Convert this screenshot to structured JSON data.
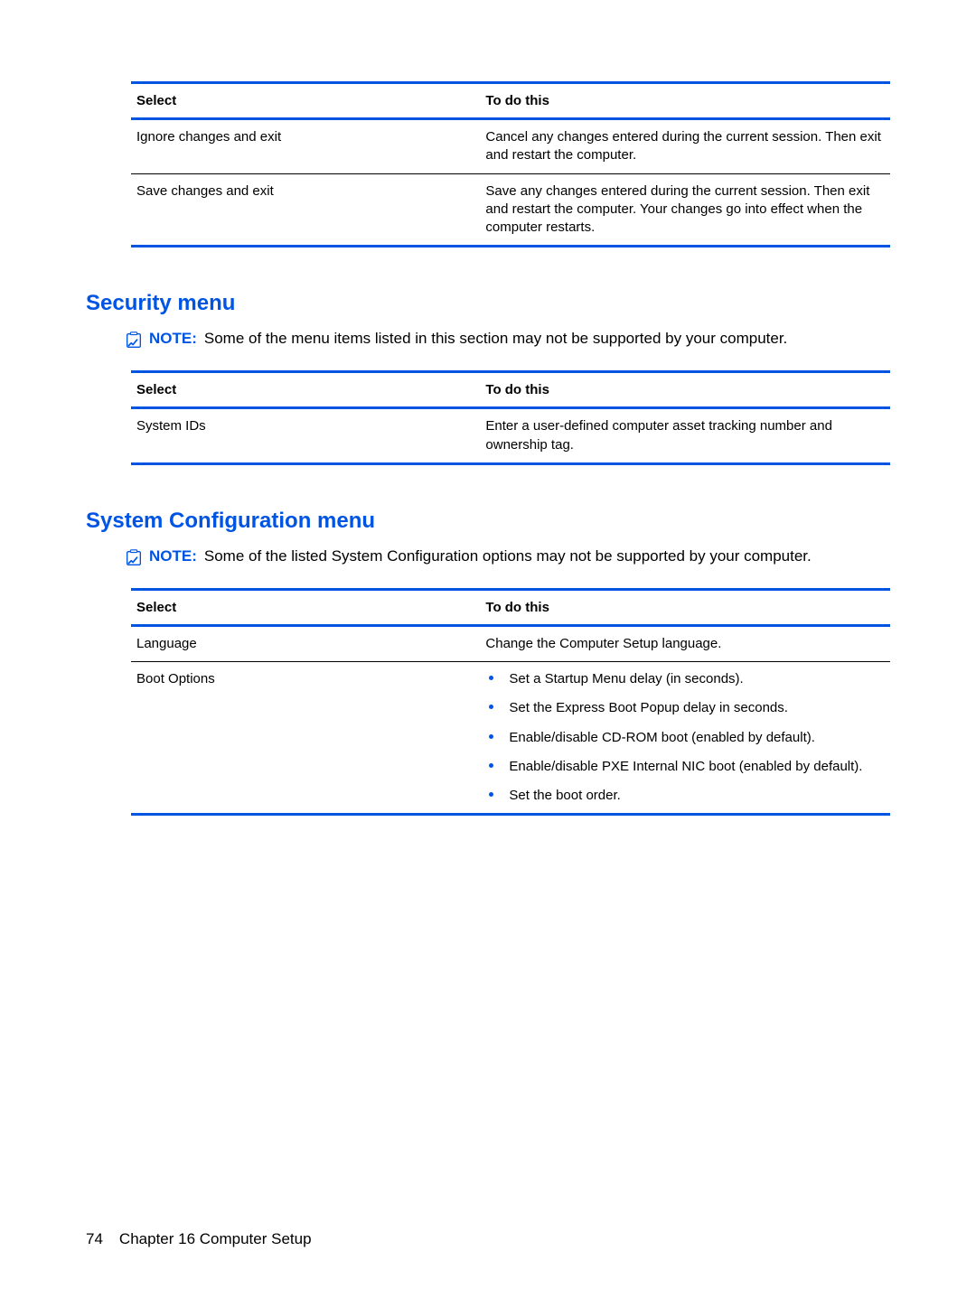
{
  "tables": {
    "top": {
      "headers": {
        "select": "Select",
        "todo": "To do this"
      },
      "rows": [
        {
          "select": "Ignore changes and exit",
          "todo": "Cancel any changes entered during the current session. Then exit and restart the computer."
        },
        {
          "select": "Save changes and exit",
          "todo": "Save any changes entered during the current session. Then exit and restart the computer. Your changes go into effect when the computer restarts."
        }
      ]
    },
    "security": {
      "headers": {
        "select": "Select",
        "todo": "To do this"
      },
      "rows": [
        {
          "select": "System IDs",
          "todo": "Enter a user-defined computer asset tracking number and ownership tag."
        }
      ]
    },
    "sysconfig": {
      "headers": {
        "select": "Select",
        "todo": "To do this"
      },
      "row_language": {
        "select": "Language",
        "todo": "Change the Computer Setup language."
      },
      "row_boot_label": "Boot Options",
      "boot_items": [
        "Set a Startup Menu delay (in seconds).",
        "Set the Express Boot Popup delay in seconds.",
        "Enable/disable CD-ROM boot (enabled by default).",
        "Enable/disable PXE Internal NIC boot (enabled by default).",
        "Set the boot order."
      ]
    }
  },
  "headings": {
    "security": "Security menu",
    "sysconfig": "System Configuration menu"
  },
  "notes": {
    "label": "NOTE:",
    "security": "Some of the menu items listed in this section may not be supported by your computer.",
    "sysconfig": "Some of the listed System Configuration options may not be supported by your computer."
  },
  "footer": {
    "page": "74",
    "chapter": "Chapter 16   Computer Setup"
  }
}
